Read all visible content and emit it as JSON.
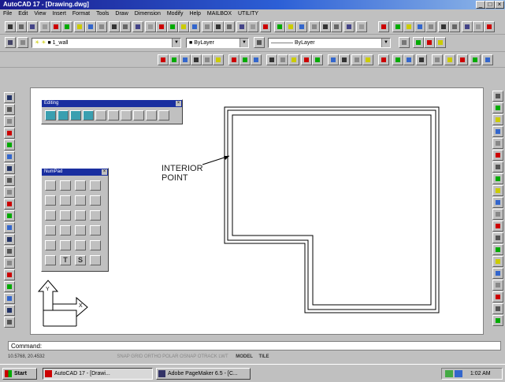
{
  "title": "AutoCAD 17 - [Drawing.dwg]",
  "menu": [
    "File",
    "Edit",
    "View",
    "Insert",
    "Format",
    "Tools",
    "Draw",
    "Dimension",
    "Modify",
    "Help",
    "MAILBOX",
    "UTILITY"
  ],
  "layer_combo": "1_wall",
  "color_combo": "ByLayer",
  "linetype_combo": "ByLayer",
  "linetype2_combo": "ByLayer",
  "editing_palette": {
    "title": "Editing"
  },
  "numpad_palette": {
    "title": "NumPad",
    "bottom_labels": [
      "T",
      "S"
    ]
  },
  "annotation": {
    "line1": "INTERIOR",
    "line2": "POINT"
  },
  "ucs": {
    "y_label": "Y",
    "x_label": "X"
  },
  "command_line": "Command:",
  "status_text": "10.5768, 20.4532",
  "status_modes": "SNAP  GRID  ORTHO  POLAR  OSNAP  OTRACK  LWT",
  "status_model": "MODEL",
  "status_tile": "TILE",
  "taskbar": {
    "start": "Start",
    "task1": "AutoCAD 17 - [Drawi...",
    "task2": "Adobe PageMaker 6.5 - [C...",
    "clock": "1:02 AM"
  },
  "colors": {
    "title_blue": "#1a1a8c",
    "canvas": "#ffffff",
    "face": "#c0c0c0"
  }
}
